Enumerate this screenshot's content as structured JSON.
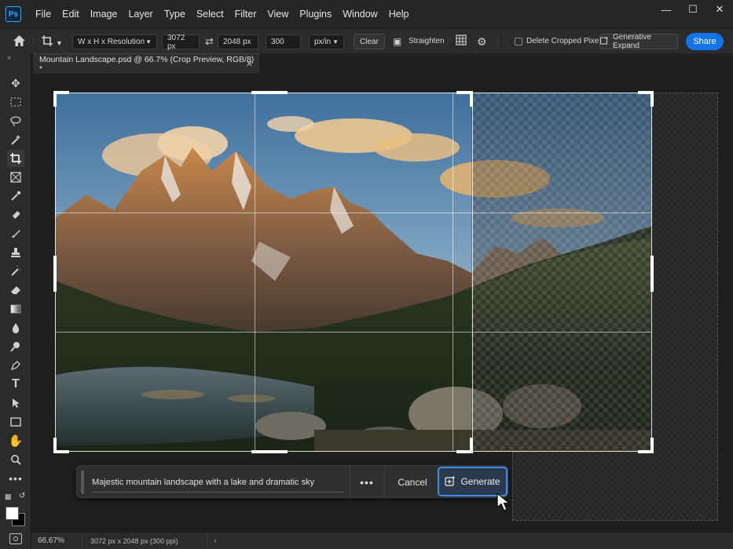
{
  "app": {
    "logo_text": "Ps"
  },
  "menu": [
    "File",
    "Edit",
    "Image",
    "Layer",
    "Type",
    "Select",
    "Filter",
    "View",
    "Plugins",
    "Window",
    "Help"
  ],
  "options": {
    "ratio_preset": "W x H x Resolution",
    "width": "3072 px",
    "height": "2048 px",
    "resolution": "300",
    "resolution_unit": "px/in",
    "clear_label": "Clear",
    "straighten_label": "Straighten",
    "delete_cropped_label": "Delete Cropped Pixels",
    "delete_cropped_checked": false,
    "generative_expand_label": "Generative Expand",
    "share_label": "Share"
  },
  "document": {
    "tab_title": "Mountain Landscape.psd @ 66.7% (Crop Preview, RGB/8) *"
  },
  "taskbar": {
    "prompt_value": "Majestic mountain landscape with a lake and dramatic sky",
    "cancel_label": "Cancel",
    "generate_label": "Generate"
  },
  "status": {
    "zoom": "66.67%",
    "doc_info": "3072 px x 2048 px (300 ppi)"
  },
  "colors": {
    "accent": "#1473e6",
    "generate_border": "#3b8df0",
    "foreground_swatch": "#ffffff",
    "background_swatch": "#000000"
  },
  "icons": [
    "home-icon",
    "crop-icon",
    "swap-icon",
    "grid-overlay-icon",
    "gear-icon",
    "straighten-icon",
    "generative-expand-icon",
    "move-icon",
    "marquee-icon",
    "lasso-icon",
    "magic-wand-icon",
    "crop-tool-icon",
    "frame-icon",
    "eyedropper-icon",
    "healing-icon",
    "brush-icon",
    "stamp-icon",
    "history-brush-icon",
    "eraser-icon",
    "gradient-icon",
    "blur-icon",
    "dodge-icon",
    "pen-icon",
    "type-icon",
    "path-select-icon",
    "rectangle-icon",
    "hand-icon",
    "zoom-icon",
    "more-tools-icon",
    "pointer-cursor-icon"
  ]
}
